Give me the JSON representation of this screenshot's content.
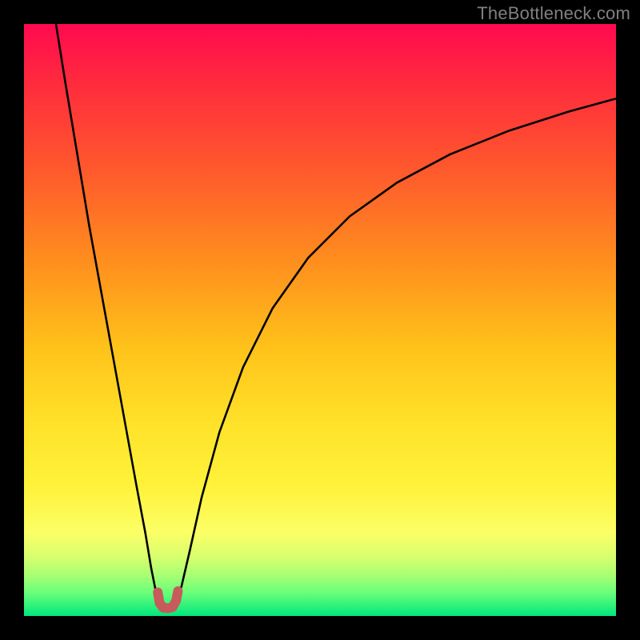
{
  "watermark": "TheBottleneck.com",
  "chart_data": {
    "type": "line",
    "title": "",
    "xlabel": "",
    "ylabel": "",
    "xlim": [
      0,
      100
    ],
    "ylim": [
      0,
      100
    ],
    "background_gradient": [
      {
        "stop": 0,
        "color": "#ff0a4f"
      },
      {
        "stop": 10,
        "color": "#ff2b3d"
      },
      {
        "stop": 25,
        "color": "#ff5a2c"
      },
      {
        "stop": 40,
        "color": "#ff8e1e"
      },
      {
        "stop": 55,
        "color": "#ffc31a"
      },
      {
        "stop": 68,
        "color": "#ffe32a"
      },
      {
        "stop": 78,
        "color": "#fff23a"
      },
      {
        "stop": 86,
        "color": "#fbff66"
      },
      {
        "stop": 90,
        "color": "#d7ff6e"
      },
      {
        "stop": 93,
        "color": "#aaff73"
      },
      {
        "stop": 96,
        "color": "#6bff79"
      },
      {
        "stop": 100,
        "color": "#00e77d"
      }
    ],
    "series": [
      {
        "name": "curve",
        "stroke": "#000000",
        "stroke_width": 2.6,
        "points": [
          {
            "x": 5.4,
            "y": 100.0
          },
          {
            "x": 7.0,
            "y": 90.0
          },
          {
            "x": 9.0,
            "y": 78.0
          },
          {
            "x": 11.0,
            "y": 66.0
          },
          {
            "x": 13.0,
            "y": 55.0
          },
          {
            "x": 15.0,
            "y": 44.0
          },
          {
            "x": 17.0,
            "y": 33.0
          },
          {
            "x": 19.0,
            "y": 22.0
          },
          {
            "x": 20.5,
            "y": 14.0
          },
          {
            "x": 21.5,
            "y": 8.0
          },
          {
            "x": 22.3,
            "y": 4.0
          },
          {
            "x": 23.0,
            "y": 2.0
          },
          {
            "x": 23.8,
            "y": 1.4
          },
          {
            "x": 24.6,
            "y": 1.4
          },
          {
            "x": 25.4,
            "y": 2.0
          },
          {
            "x": 26.6,
            "y": 5.0
          },
          {
            "x": 28.0,
            "y": 11.0
          },
          {
            "x": 30.0,
            "y": 20.0
          },
          {
            "x": 33.0,
            "y": 31.0
          },
          {
            "x": 37.0,
            "y": 42.0
          },
          {
            "x": 42.0,
            "y": 52.0
          },
          {
            "x": 48.0,
            "y": 60.5
          },
          {
            "x": 55.0,
            "y": 67.5
          },
          {
            "x": 63.0,
            "y": 73.2
          },
          {
            "x": 72.0,
            "y": 78.0
          },
          {
            "x": 82.0,
            "y": 82.0
          },
          {
            "x": 92.0,
            "y": 85.2
          },
          {
            "x": 100.0,
            "y": 87.4
          }
        ]
      },
      {
        "name": "marker",
        "stroke": "#c75a5a",
        "stroke_width": 12,
        "linecap": "round",
        "points": [
          {
            "x": 22.6,
            "y": 4.0
          },
          {
            "x": 22.9,
            "y": 2.2
          },
          {
            "x": 23.5,
            "y": 1.4
          },
          {
            "x": 24.3,
            "y": 1.3
          },
          {
            "x": 25.1,
            "y": 1.5
          },
          {
            "x": 25.7,
            "y": 2.6
          },
          {
            "x": 26.0,
            "y": 4.2
          }
        ]
      }
    ]
  }
}
